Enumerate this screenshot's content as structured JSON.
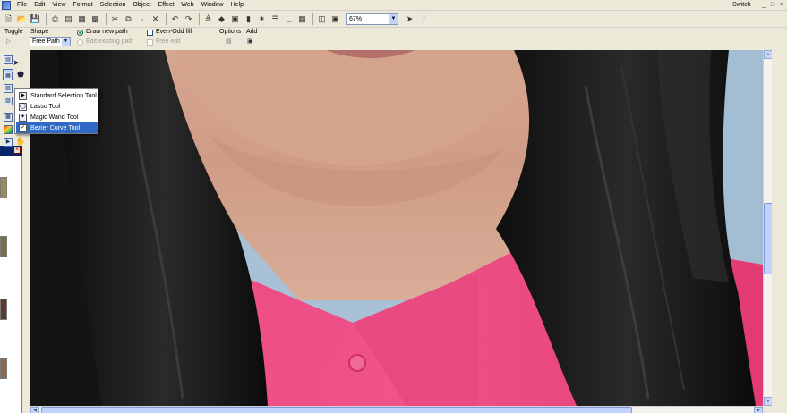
{
  "menubar": {
    "items": [
      "File",
      "Edit",
      "View",
      "Format",
      "Selection",
      "Object",
      "Effect",
      "Web",
      "Window",
      "Help"
    ],
    "switch_label": "Switch"
  },
  "toolbar": {
    "zoom_value": "67%"
  },
  "attributes": {
    "toggle_label": "Toggle",
    "shape_label": "Shape",
    "shape_value": "Free Path",
    "draw_new_path": "Draw new path",
    "edit_existing_path": "Edit existing path",
    "even_odd_fill": "Even-Odd fill",
    "free_edit": "Free edit",
    "options_label": "Options",
    "add_label": "Add"
  },
  "flyout": {
    "items": [
      {
        "label": "Standard Selection Tool",
        "icon": "selection-icon",
        "selected": false
      },
      {
        "label": "Lasso Tool",
        "icon": "lasso-icon",
        "selected": false
      },
      {
        "label": "Magic Wand Tool",
        "icon": "magic-wand-icon",
        "selected": false
      },
      {
        "label": "Bezier Curve Tool",
        "icon": "bezier-curve-icon",
        "selected": true
      }
    ]
  },
  "colors": {
    "hair": "#121212",
    "skin": "#d8a993",
    "shirt": "#e5336f",
    "wall": "#a9c1d6",
    "selection_blue": "#316ac5"
  }
}
